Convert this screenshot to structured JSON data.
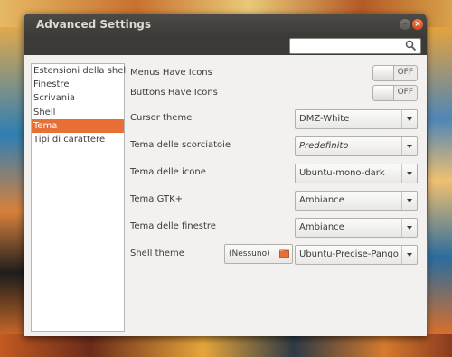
{
  "window": {
    "title": "Advanced Settings"
  },
  "search": {
    "placeholder": "",
    "value": ""
  },
  "sidebar": {
    "items": [
      {
        "label": "Estensioni della shell",
        "selected": false
      },
      {
        "label": "Finestre",
        "selected": false
      },
      {
        "label": "Scrivania",
        "selected": false
      },
      {
        "label": "Shell",
        "selected": false
      },
      {
        "label": "Tema",
        "selected": true
      },
      {
        "label": "Tipi di carattere",
        "selected": false
      }
    ]
  },
  "settings": {
    "menus_have_icons": {
      "label": "Menus Have Icons",
      "state": "OFF"
    },
    "buttons_have_icons": {
      "label": "Buttons Have Icons",
      "state": "OFF"
    },
    "cursor_theme": {
      "label": "Cursor theme",
      "value": "DMZ-White"
    },
    "shortcut_theme": {
      "label": "Tema delle scorciatoie",
      "value": "Predefinito"
    },
    "icon_theme": {
      "label": "Tema delle icone",
      "value": "Ubuntu-mono-dark"
    },
    "gtk_theme": {
      "label": "Tema GTK+",
      "value": "Ambiance"
    },
    "window_theme": {
      "label": "Tema delle finestre",
      "value": "Ambiance"
    },
    "shell_theme": {
      "label": "Shell theme",
      "file_button": "(Nessuno)",
      "value": "Ubuntu-Precise-Pangolin"
    }
  },
  "colors": {
    "accent": "#e86f35",
    "titlebar": "#3c3b37",
    "window_bg": "#f2f1f0"
  },
  "icons": {
    "search": "search-icon",
    "close": "close-icon",
    "minimize": "minimize-icon",
    "folder": "folder-icon"
  }
}
